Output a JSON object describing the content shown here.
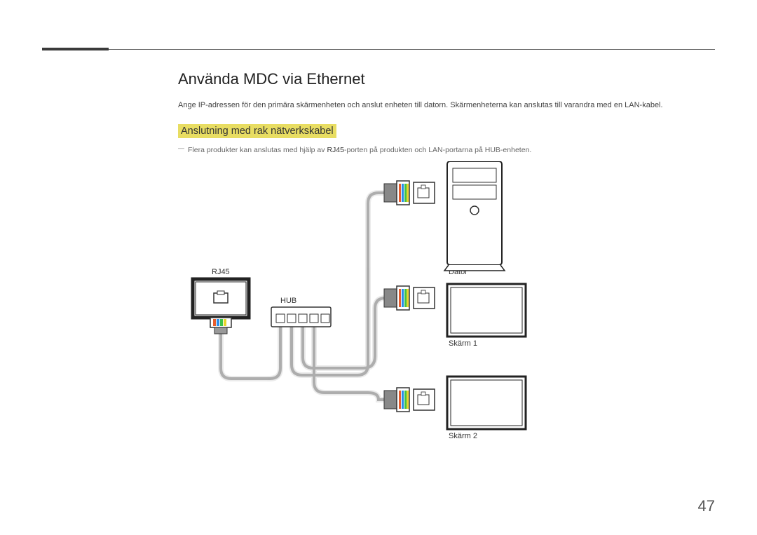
{
  "heading": "Använda MDC via Ethernet",
  "intro": "Ange IP-adressen för den primära skärmenheten och anslut enheten till datorn. Skärmenheterna kan anslutas till varandra med en LAN-kabel.",
  "subheading": "Anslutning med rak nätverkskabel",
  "note_prefix": "Flera produkter kan anslutas med hjälp av ",
  "note_highlight": "RJ45",
  "note_suffix": "-porten på produkten och LAN-portarna på HUB-enheten.",
  "labels": {
    "rj45": "RJ45",
    "hub": "HUB",
    "dator": "Dator",
    "skarm1": "Skärm 1",
    "skarm2": "Skärm 2"
  },
  "page_number": "47"
}
